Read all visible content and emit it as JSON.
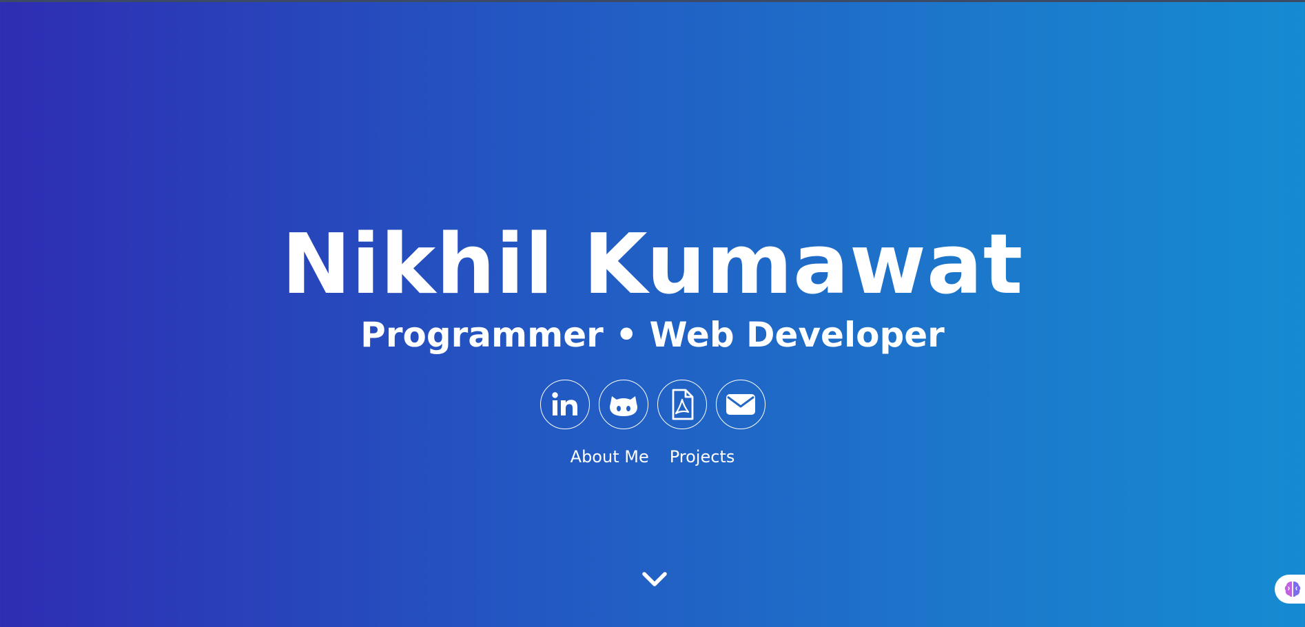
{
  "hero": {
    "name": "Nikhil Kumawat",
    "subtitle": "Programmer • Web Developer"
  },
  "social_links": [
    {
      "icon": "linkedin-icon"
    },
    {
      "icon": "github-icon"
    },
    {
      "icon": "pdf-resume-icon"
    },
    {
      "icon": "email-icon"
    }
  ],
  "nav": {
    "about_label": "About Me",
    "projects_label": "Projects"
  },
  "scroll": {
    "icon": "chevron-down-icon"
  },
  "assistant": {
    "icon": "brain-icon"
  },
  "colors": {
    "gradient_start": "#2e2db3",
    "gradient_end": "#158bd2",
    "text": "#ffffff"
  }
}
